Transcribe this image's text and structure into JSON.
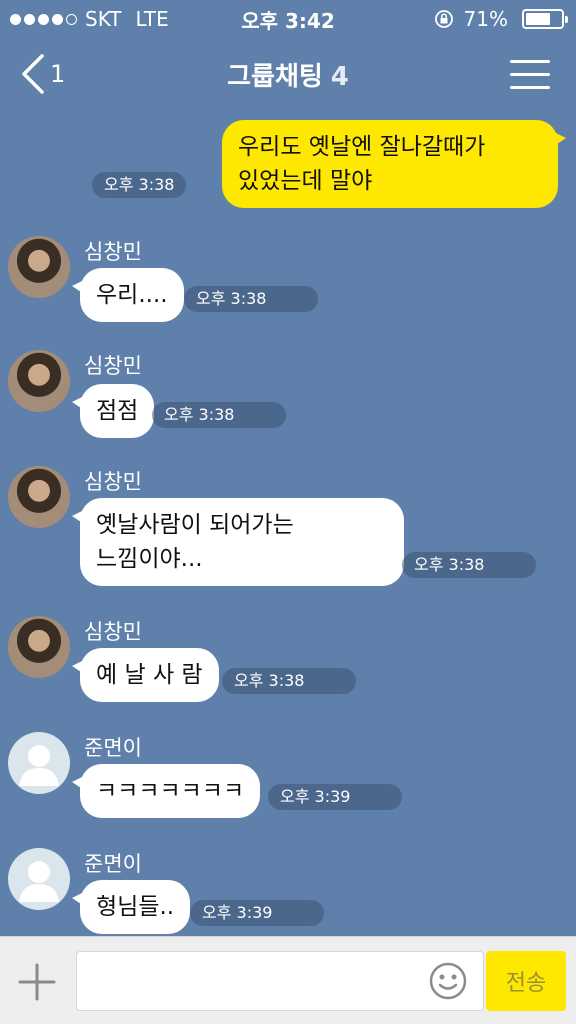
{
  "status_bar": {
    "carrier": "SKT",
    "network": "LTE",
    "time": "오후 3:42",
    "battery": "71%",
    "battery_level": 0.71
  },
  "nav": {
    "back_count": "1",
    "title": "그룹채팅",
    "member_count": "4"
  },
  "messages": [
    {
      "direction": "out",
      "text": "우리도 옛날엔 잘나갈때가 있었는데 말야",
      "time": "오후 3:38"
    },
    {
      "direction": "in",
      "sender": "심창민",
      "text": "우리....",
      "time": "오후 3:38"
    },
    {
      "direction": "in",
      "sender": "심창민",
      "text": "점점",
      "time": "오후 3:38"
    },
    {
      "direction": "in",
      "sender": "심창민",
      "text": "옛날사람이 되어가는 느낌이야...",
      "time": "오후 3:38"
    },
    {
      "direction": "in",
      "sender": "심창민",
      "text": "예 날 사 람",
      "time": "오후 3:38"
    },
    {
      "direction": "in",
      "sender": "준면이",
      "text": "ㅋㅋㅋㅋㅋㅋㅋ",
      "time": "오후 3:39"
    },
    {
      "direction": "in",
      "sender": "준면이",
      "text": "형님들..",
      "time": "오후 3:39"
    }
  ],
  "input_bar": {
    "placeholder": "",
    "send_label": "전송"
  },
  "colors": {
    "background": "#5f80aa",
    "outgoing_bubble": "#ffe800",
    "incoming_bubble": "#ffffff",
    "send_button": "#ffe800"
  }
}
